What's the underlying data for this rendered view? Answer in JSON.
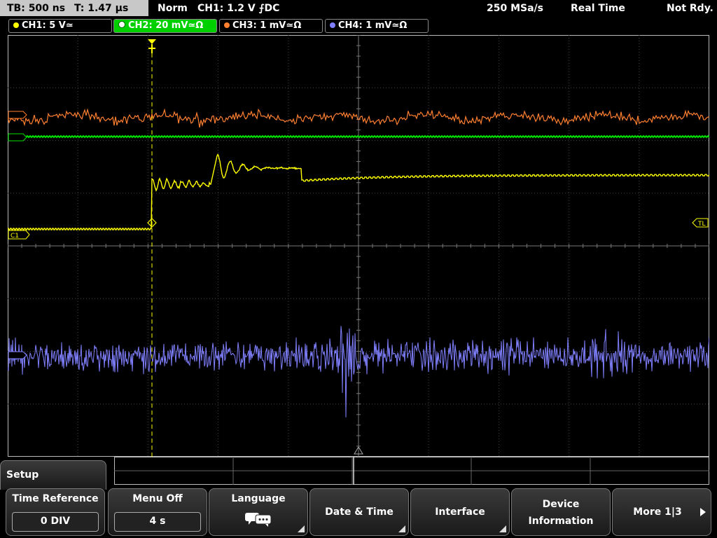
{
  "status": {
    "timebase": "TB: 500 ns",
    "trigger_time": "T: 1.47 µs",
    "trigger_mode": "Norm",
    "trigger_info": "CH1: 1.2 V ⨍DC",
    "sample_rate": "250 MSa/s",
    "acq_mode": "Real Time",
    "state": "Not Rdy."
  },
  "channels": [
    {
      "label": "CH1: 5 V≃",
      "color": "#ffff00"
    },
    {
      "label": "CH2: 20 mV≃Ω",
      "color": "#00e000"
    },
    {
      "label": "CH3: 1 mV≃Ω",
      "color": "#ff8030"
    },
    {
      "label": "CH4: 1 mV≃Ω",
      "color": "#8080ff"
    }
  ],
  "markers": {
    "ch1": "C1",
    "trigger_level": "TL"
  },
  "menu": {
    "title": "Setup",
    "softkeys": [
      {
        "label": "Time Reference",
        "value": "0 DIV"
      },
      {
        "label": "Menu Off",
        "value": "4 s"
      },
      {
        "label": "Language",
        "icon": "speech-bubbles-icon"
      },
      {
        "label": "Date & Time"
      },
      {
        "label": "Interface"
      },
      {
        "label": "Device",
        "label2": "Information"
      },
      {
        "label": "More 1|3"
      }
    ]
  }
}
